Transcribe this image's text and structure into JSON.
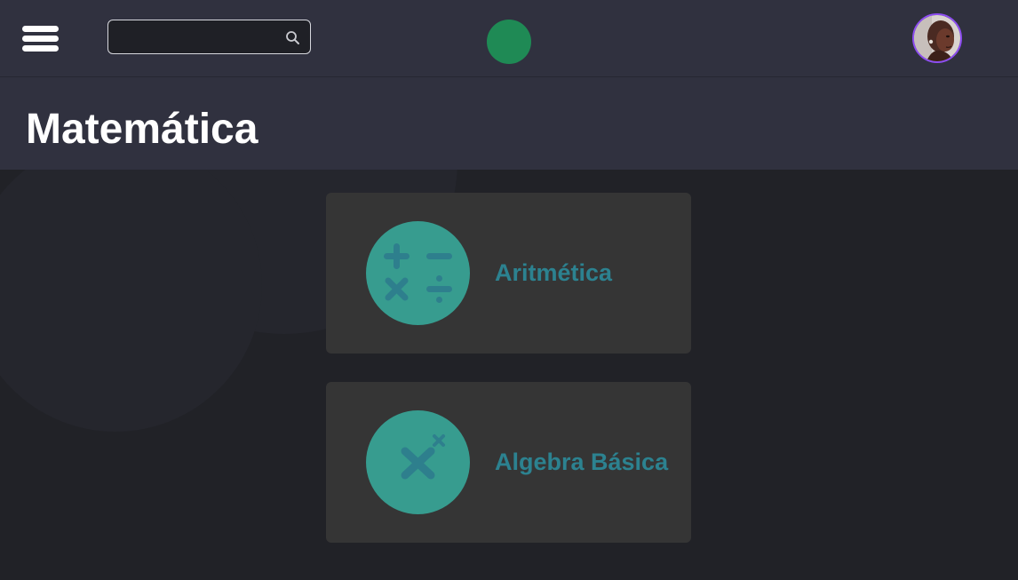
{
  "topbar": {
    "menu_icon": "hamburger-menu-icon",
    "search": {
      "placeholder": "",
      "value": "",
      "icon": "search-icon"
    },
    "logo_color": "#1f8a55",
    "avatar_border_color": "#8d4df2"
  },
  "header": {
    "title": "Matemática"
  },
  "topics": [
    {
      "label": "Aritmética",
      "icon": "arithmetic-operators-icon"
    },
    {
      "label": "Algebra Básica",
      "icon": "algebra-variable-icon"
    }
  ],
  "colors": {
    "topbar": "#30313f",
    "background": "#212227",
    "card": "#353535",
    "icon_circle": "#379c8f",
    "icon_glyph": "#2e7f8d",
    "topic_label": "#2c8290"
  }
}
